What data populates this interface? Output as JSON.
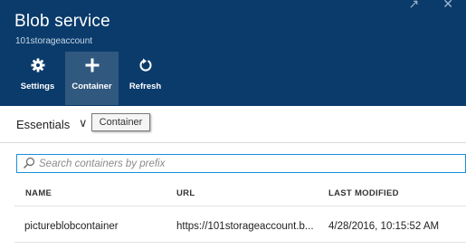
{
  "header": {
    "title": "Blob service",
    "subtitle": "101storageaccount",
    "window_icons": [
      "pin-icon",
      "close-icon"
    ]
  },
  "toolbar": {
    "buttons": [
      {
        "label": "Settings",
        "icon": "gear-icon"
      },
      {
        "label": "Container",
        "icon": "plus-icon",
        "active": true
      },
      {
        "label": "Refresh",
        "icon": "refresh-icon"
      }
    ]
  },
  "essentials": {
    "label": "Essentials",
    "icon": "chevron-down-icon"
  },
  "tooltip": {
    "text": "Container"
  },
  "search": {
    "placeholder": "Search containers by prefix",
    "value": ""
  },
  "table": {
    "columns": [
      "NAME",
      "URL",
      "LAST MODIFIED"
    ],
    "rows": [
      {
        "name": "pictureblobcontainer",
        "url": "https://101storageaccount.b...",
        "last_modified": "4/28/2016, 10:15:52 AM"
      }
    ]
  },
  "colors": {
    "header_bg": "#0a3b6b",
    "active_button_bg": "#31587f",
    "search_border": "#1a8fd8"
  }
}
